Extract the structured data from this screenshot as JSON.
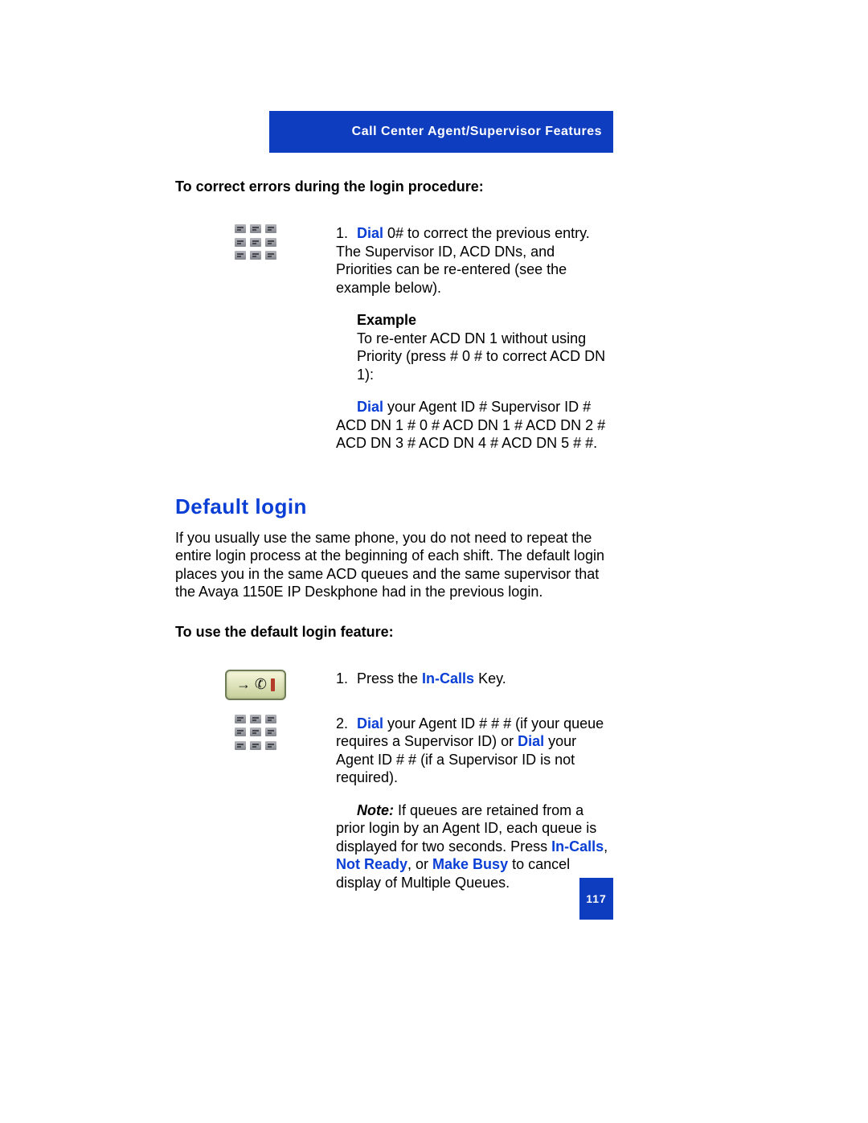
{
  "header": "Call Center Agent/Supervisor Features",
  "subhead1": "To correct errors during the login procedure:",
  "step1": {
    "num": "1.",
    "dial": "Dial",
    "rest": " 0# to correct the previous entry. The Supervisor ID, ACD DNs, and Priorities can be re-entered (see the example below)."
  },
  "example": {
    "label": "Example",
    "line1": "To re-enter ACD DN 1 without using Priority (press # 0 # to correct ACD DN 1):",
    "dial": "Dial",
    "seq": " your Agent ID # Supervisor ID # ACD DN 1 # 0 # ACD DN 1 # ACD DN 2 # ACD DN 3 # ACD DN 4 # ACD DN 5 # #."
  },
  "section_title": "Default login",
  "section_body": "If you usually use the same phone, you do not need to repeat the entire login process at the beginning of each shift. The default login places you in the same ACD queues and the same supervisor that the Avaya 1150E IP Deskphone had in the previous login.",
  "subhead2": "To use the default login feature:",
  "step_a": {
    "num": "1.",
    "pre": "Press the ",
    "incalls": "In-Calls",
    "post": " Key."
  },
  "step_b": {
    "num": "2.",
    "dial1": "Dial",
    "mid1": " your Agent ID # # # (if your queue requires a Supervisor ID) or ",
    "dial2": "Dial",
    "mid2": " your Agent ID # # (if a Supervisor ID is not required)."
  },
  "note": {
    "label": "Note:",
    "pre": " If queues are retained from a prior login by an Agent ID, each queue is displayed for two seconds. Press ",
    "incalls": "In-Calls",
    "sep1": ", ",
    "notready": "Not Ready",
    "sep2": ", or ",
    "makebusy": "Make Busy",
    "post": " to cancel display of Multiple Queues."
  },
  "page_number": "117"
}
